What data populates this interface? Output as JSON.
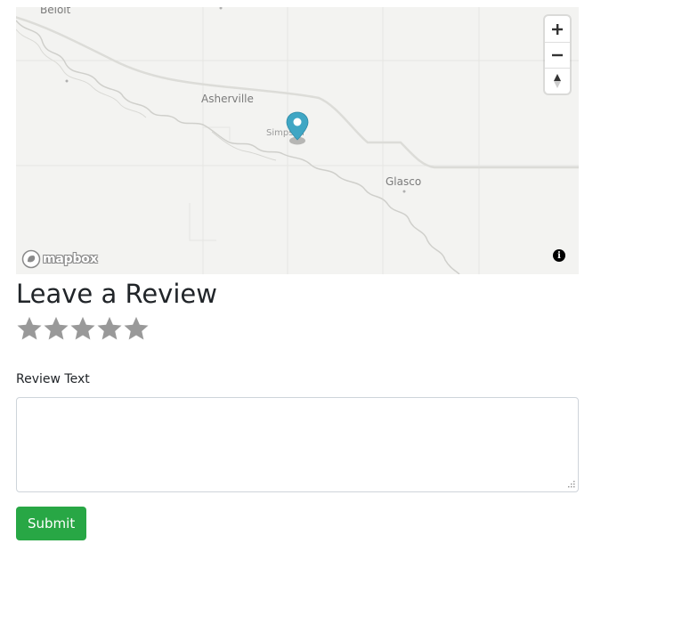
{
  "map": {
    "places": {
      "beloit": "Beloit",
      "asherville": "Asherville",
      "simpson": "Simpson",
      "glasco": "Glasco"
    },
    "controls": {
      "zoom_in_icon": "plus-icon",
      "zoom_out_icon": "minus-icon",
      "compass_icon": "compass-icon"
    },
    "attribution": {
      "logo_text": "mapbox",
      "info_glyph": "i"
    },
    "marker_color": "#3fa6c4"
  },
  "review": {
    "heading": "Leave a Review",
    "rating": {
      "max": 5,
      "selected": 0,
      "star_color": "#999999"
    },
    "text_label": "Review Text",
    "text_value": "",
    "submit_label": "Submit",
    "submit_color": "#28a745"
  }
}
